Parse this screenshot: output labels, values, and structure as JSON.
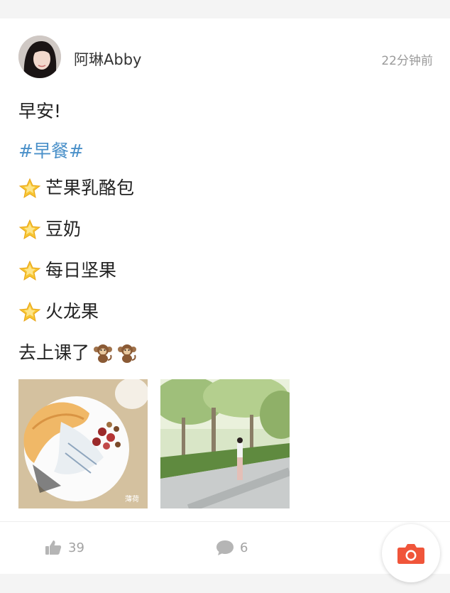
{
  "post": {
    "username": "阿琳Abby",
    "timestamp": "22分钟前",
    "greeting": "早安!",
    "hashtag": "#早餐#",
    "items": [
      "芒果乳酪包",
      "豆奶",
      "每日坚果",
      "火龙果"
    ],
    "closing": "去上课了",
    "closing_emoji": [
      "monkey-emoji",
      "monkey-emoji"
    ],
    "item_emoji": "glowing-star-emoji",
    "photos": [
      {
        "name": "breakfast-plate-photo",
        "watermark": "薄荷"
      },
      {
        "name": "tree-lined-path-photo"
      }
    ]
  },
  "actions": {
    "likes": "39",
    "comments": "6",
    "like_icon": "thumbs-up-icon",
    "comment_icon": "comment-bubble-icon",
    "camera_icon": "camera-icon"
  },
  "colors": {
    "hashtag": "#4a90c9",
    "camera": "#f0553a",
    "action_gray": "#a3a3a3"
  }
}
